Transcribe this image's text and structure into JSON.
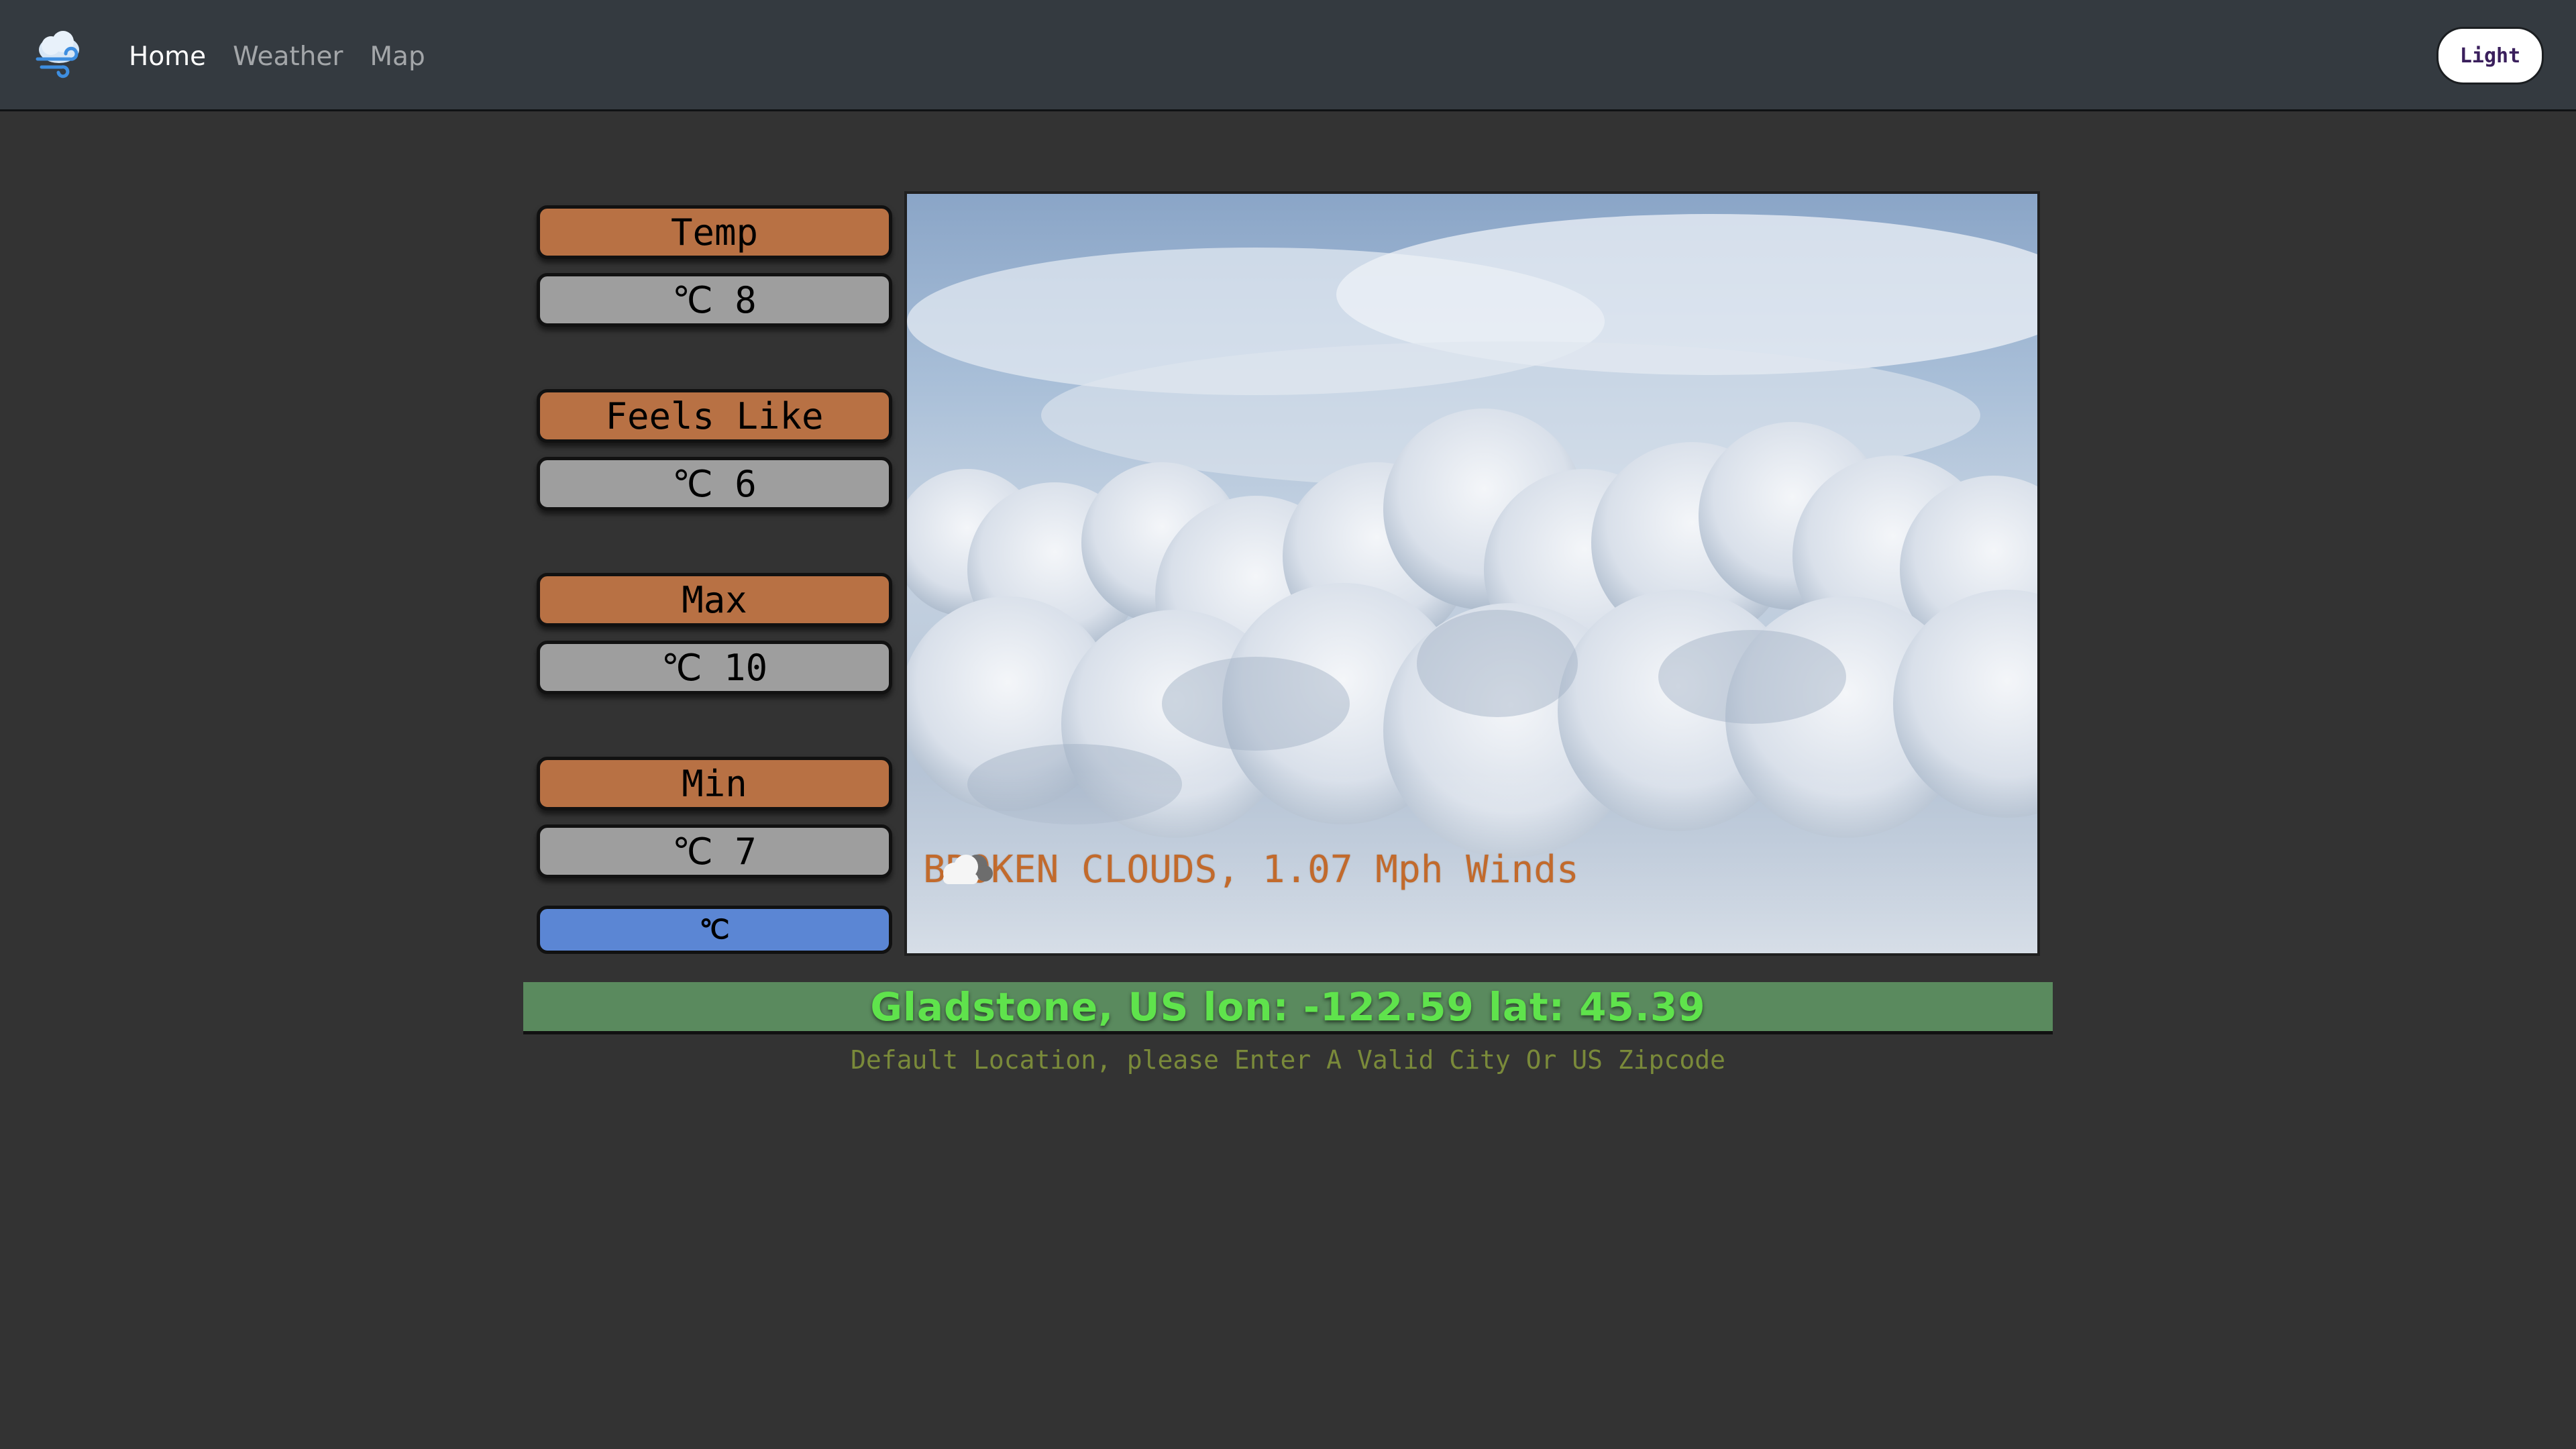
{
  "nav": {
    "logo_icon": "cloud-wind-icon",
    "links": [
      "Home",
      "Weather",
      "Map"
    ],
    "active": "Home",
    "theme_button": "Light"
  },
  "stats": [
    {
      "label": "Temp",
      "value": "℃ 8"
    },
    {
      "label": "Feels Like",
      "value": "℃ 6"
    },
    {
      "label": "Max",
      "value": "℃ 10"
    },
    {
      "label": "Min",
      "value": "℃ 7"
    }
  ],
  "unit_toggle": "℃",
  "conditions": {
    "text": "BROKEN CLOUDS, 1.07 Mph Winds",
    "icon": "cloud-icon"
  },
  "location": {
    "text": "Gladstone, US lon: -122.59 lat: 45.39",
    "note": "Default Location, please Enter A Valid City Or US Zipcode"
  },
  "colors": {
    "background": "#333333",
    "navbar": "#343a40",
    "stat_label": "#b87144",
    "stat_value": "#9e9e9e",
    "unit_toggle": "#5b86d4",
    "condition_text": "#c26a2c",
    "location_bar": "#5a8a5e",
    "location_text": "#5fe34c"
  }
}
